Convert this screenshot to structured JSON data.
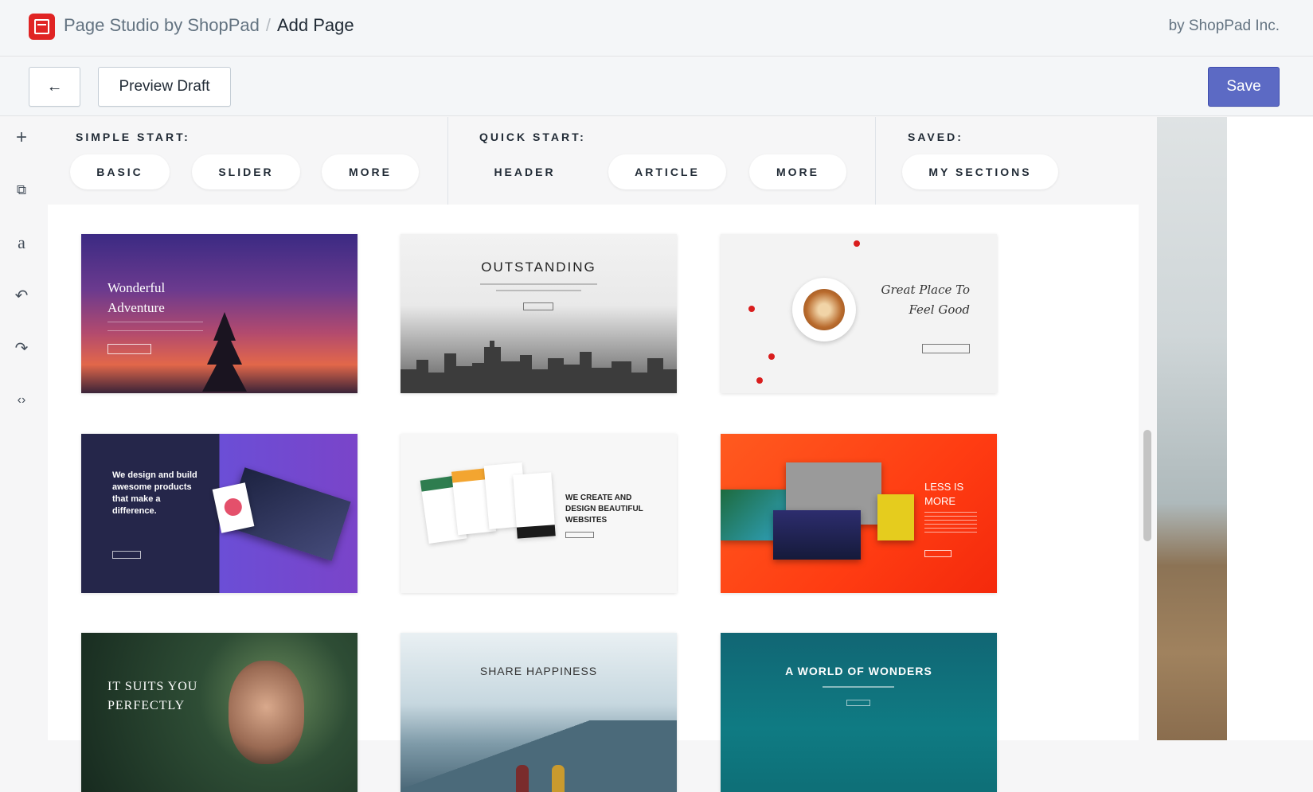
{
  "header": {
    "app_name": "Page Studio by ShopPad",
    "separator": "/",
    "page_title": "Add Page",
    "vendor": "by ShopPad Inc."
  },
  "toolbar": {
    "back_glyph": "←",
    "preview_label": "Preview Draft",
    "save_label": "Save"
  },
  "rail": {
    "icons": [
      {
        "name": "add-icon",
        "glyph": "+"
      },
      {
        "name": "duplicate-icon",
        "glyph": "⧉"
      },
      {
        "name": "text-icon",
        "glyph": "a"
      },
      {
        "name": "undo-icon",
        "glyph": "↶"
      },
      {
        "name": "redo-icon",
        "glyph": "↷"
      },
      {
        "name": "code-icon",
        "glyph": "‹›"
      }
    ]
  },
  "categories": {
    "simple": {
      "title": "SIMPLE START:",
      "items": [
        "BASIC",
        "SLIDER",
        "MORE"
      ]
    },
    "quick": {
      "title": "QUICK START:",
      "items": [
        "HEADER",
        "ARTICLE",
        "MORE"
      ]
    },
    "saved": {
      "title": "SAVED:",
      "items": [
        "MY SECTIONS"
      ]
    }
  },
  "templates": [
    {
      "title_line1": "Wonderful",
      "title_line2": "Adventure"
    },
    {
      "title": "OUTSTANDING"
    },
    {
      "title_line1": "Great Place To",
      "title_line2": "Feel Good"
    },
    {
      "text": "We design and build awesome products that make a difference."
    },
    {
      "text": "WE CREATE AND DESIGN BEAUTIFUL WEBSITES"
    },
    {
      "title_line1": "LESS IS",
      "title_line2": "MORE"
    },
    {
      "title_line1": "IT SUITS YOU",
      "title_line2": "PERFECTLY"
    },
    {
      "title": "SHARE HAPPINESS"
    },
    {
      "title": "A WORLD OF WONDERS"
    }
  ],
  "colors": {
    "brand_red": "#e02424",
    "save_button": "#5c6ac4"
  }
}
